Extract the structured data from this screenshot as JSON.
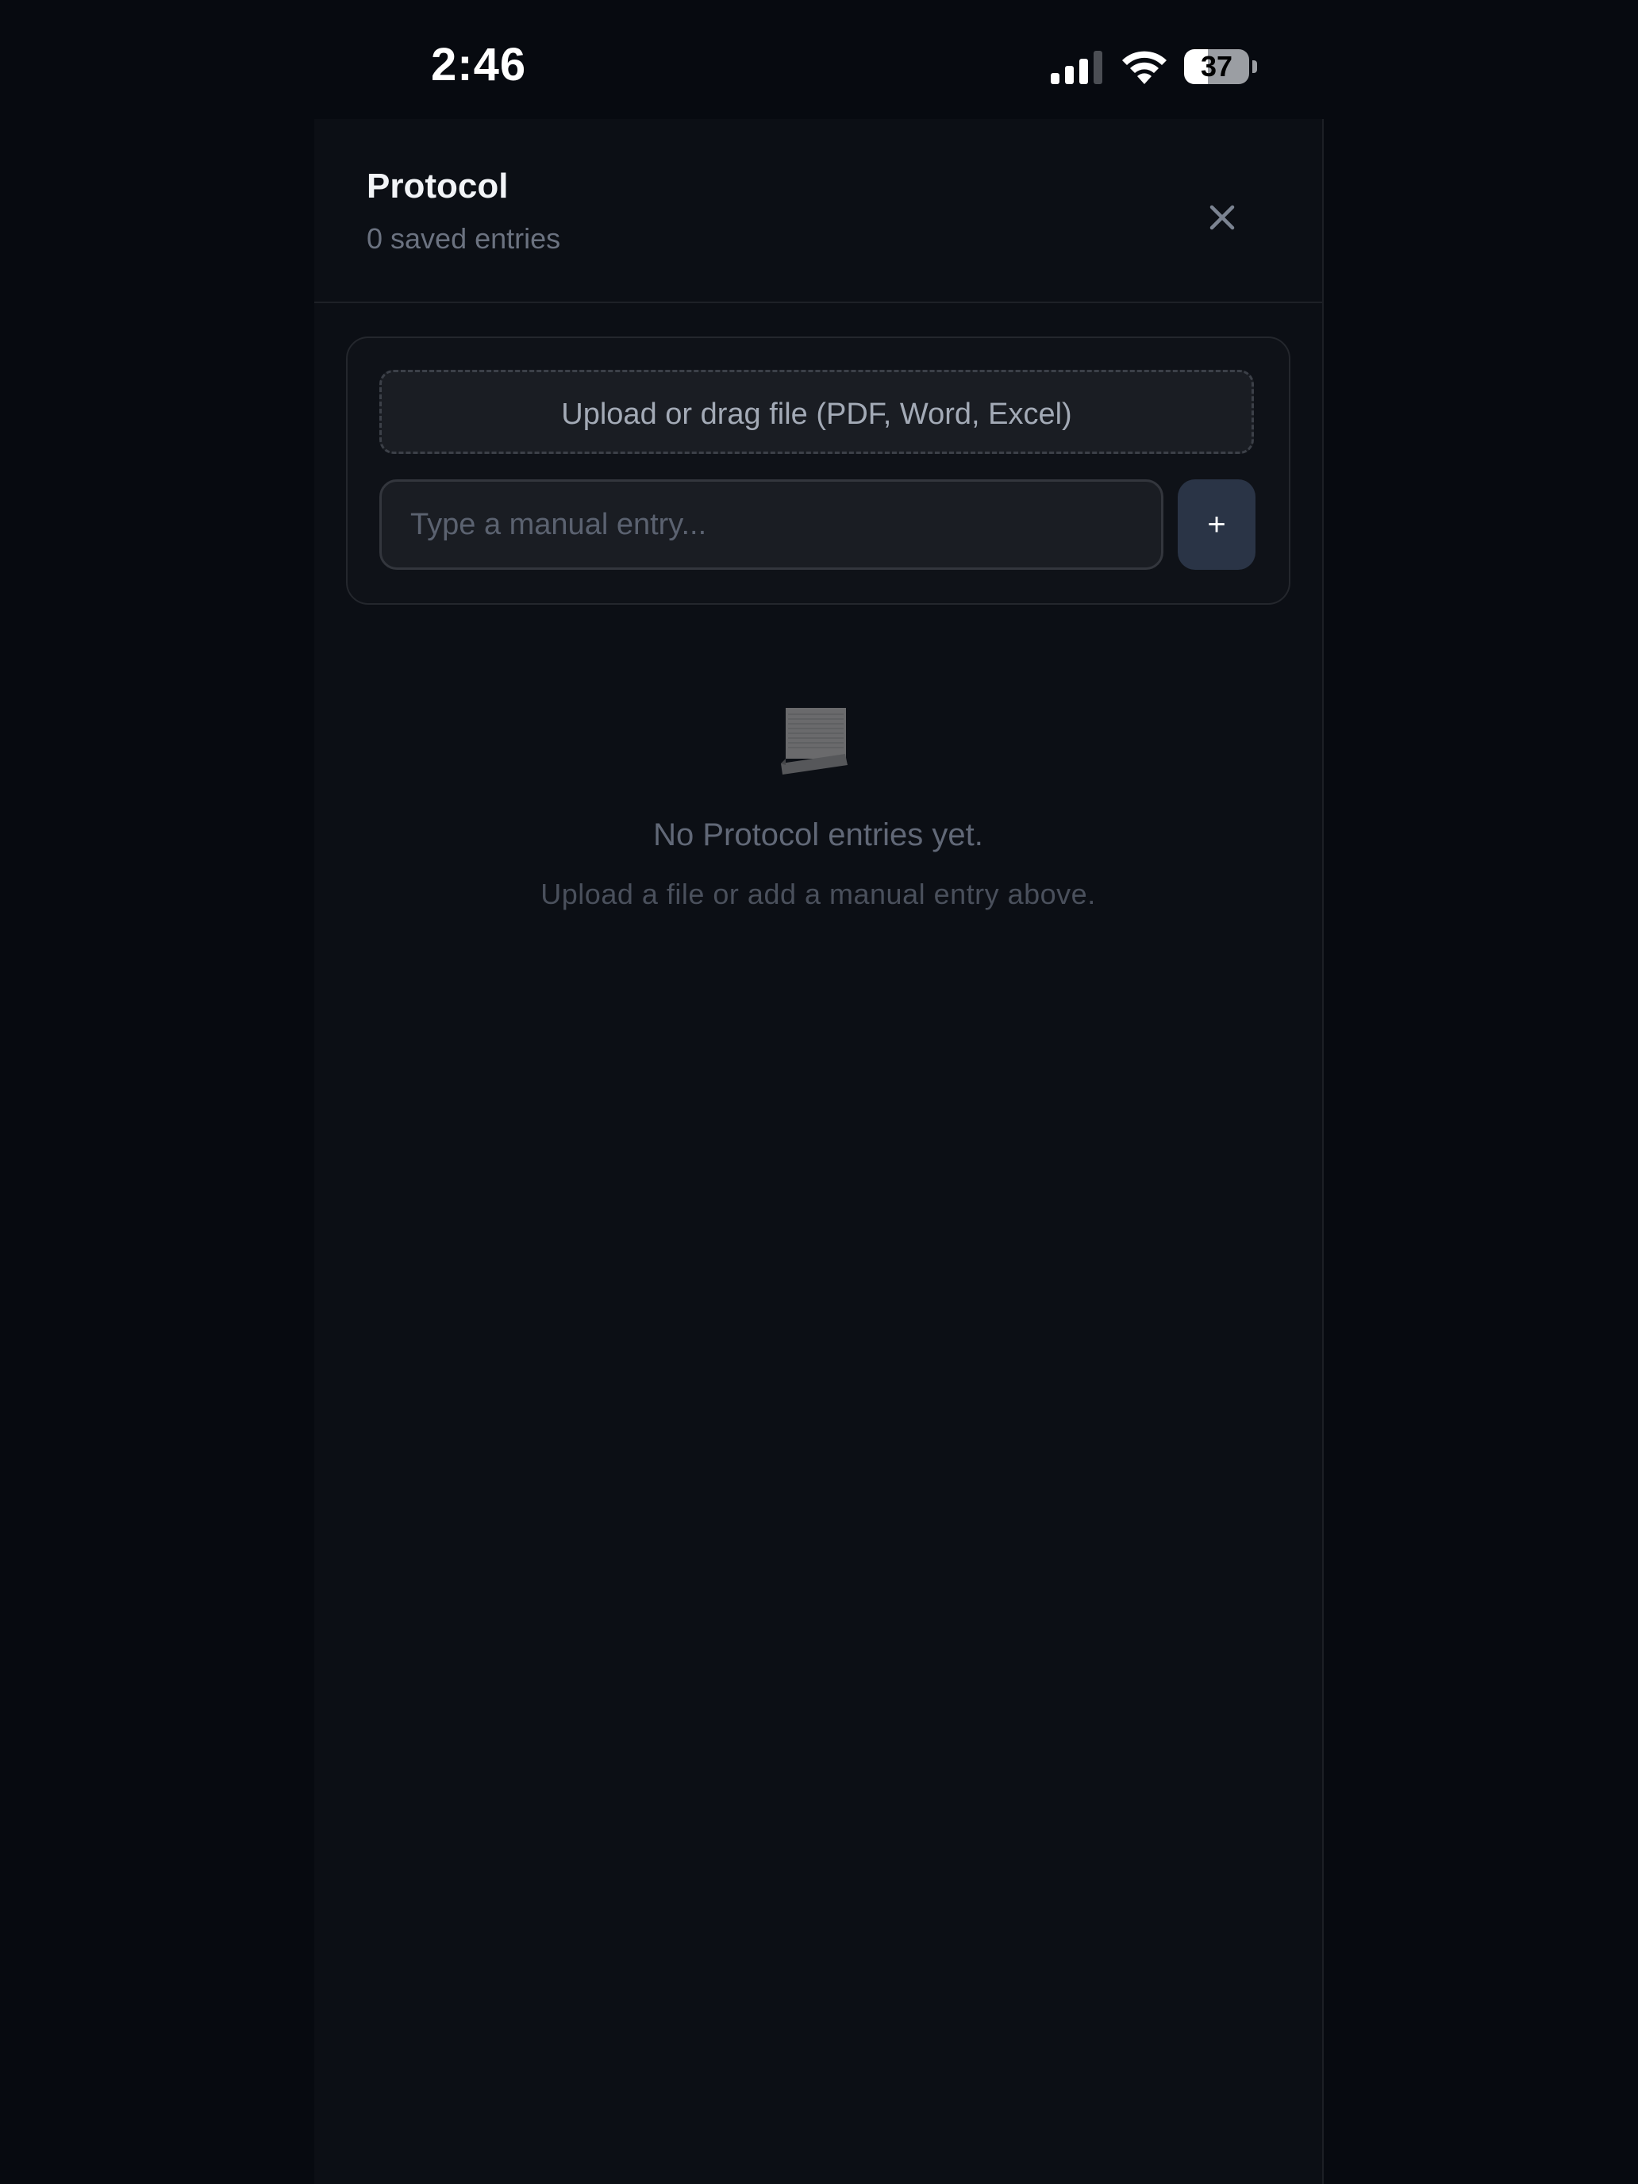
{
  "status_bar": {
    "time": "2:46",
    "battery_level": "37",
    "battery_fraction": 0.37,
    "icons": [
      "signal-icon",
      "wifi-icon",
      "battery-icon"
    ]
  },
  "header": {
    "title": "Protocol",
    "subtitle": "0 saved entries",
    "close_icon": "close-icon"
  },
  "input_card": {
    "upload_label": "Upload or drag file (PDF, Word, Excel)",
    "entry_placeholder": "Type a manual entry...",
    "entry_value": "",
    "add_label": "+"
  },
  "empty_state": {
    "icon": "scroll-icon",
    "title": "No Protocol entries yet.",
    "hint": "Upload a file or add a manual entry above."
  },
  "colors": {
    "background": "#070a10",
    "panel": "#0c0f15",
    "add_button": "#2a3446",
    "muted_text": "#6b7280"
  }
}
